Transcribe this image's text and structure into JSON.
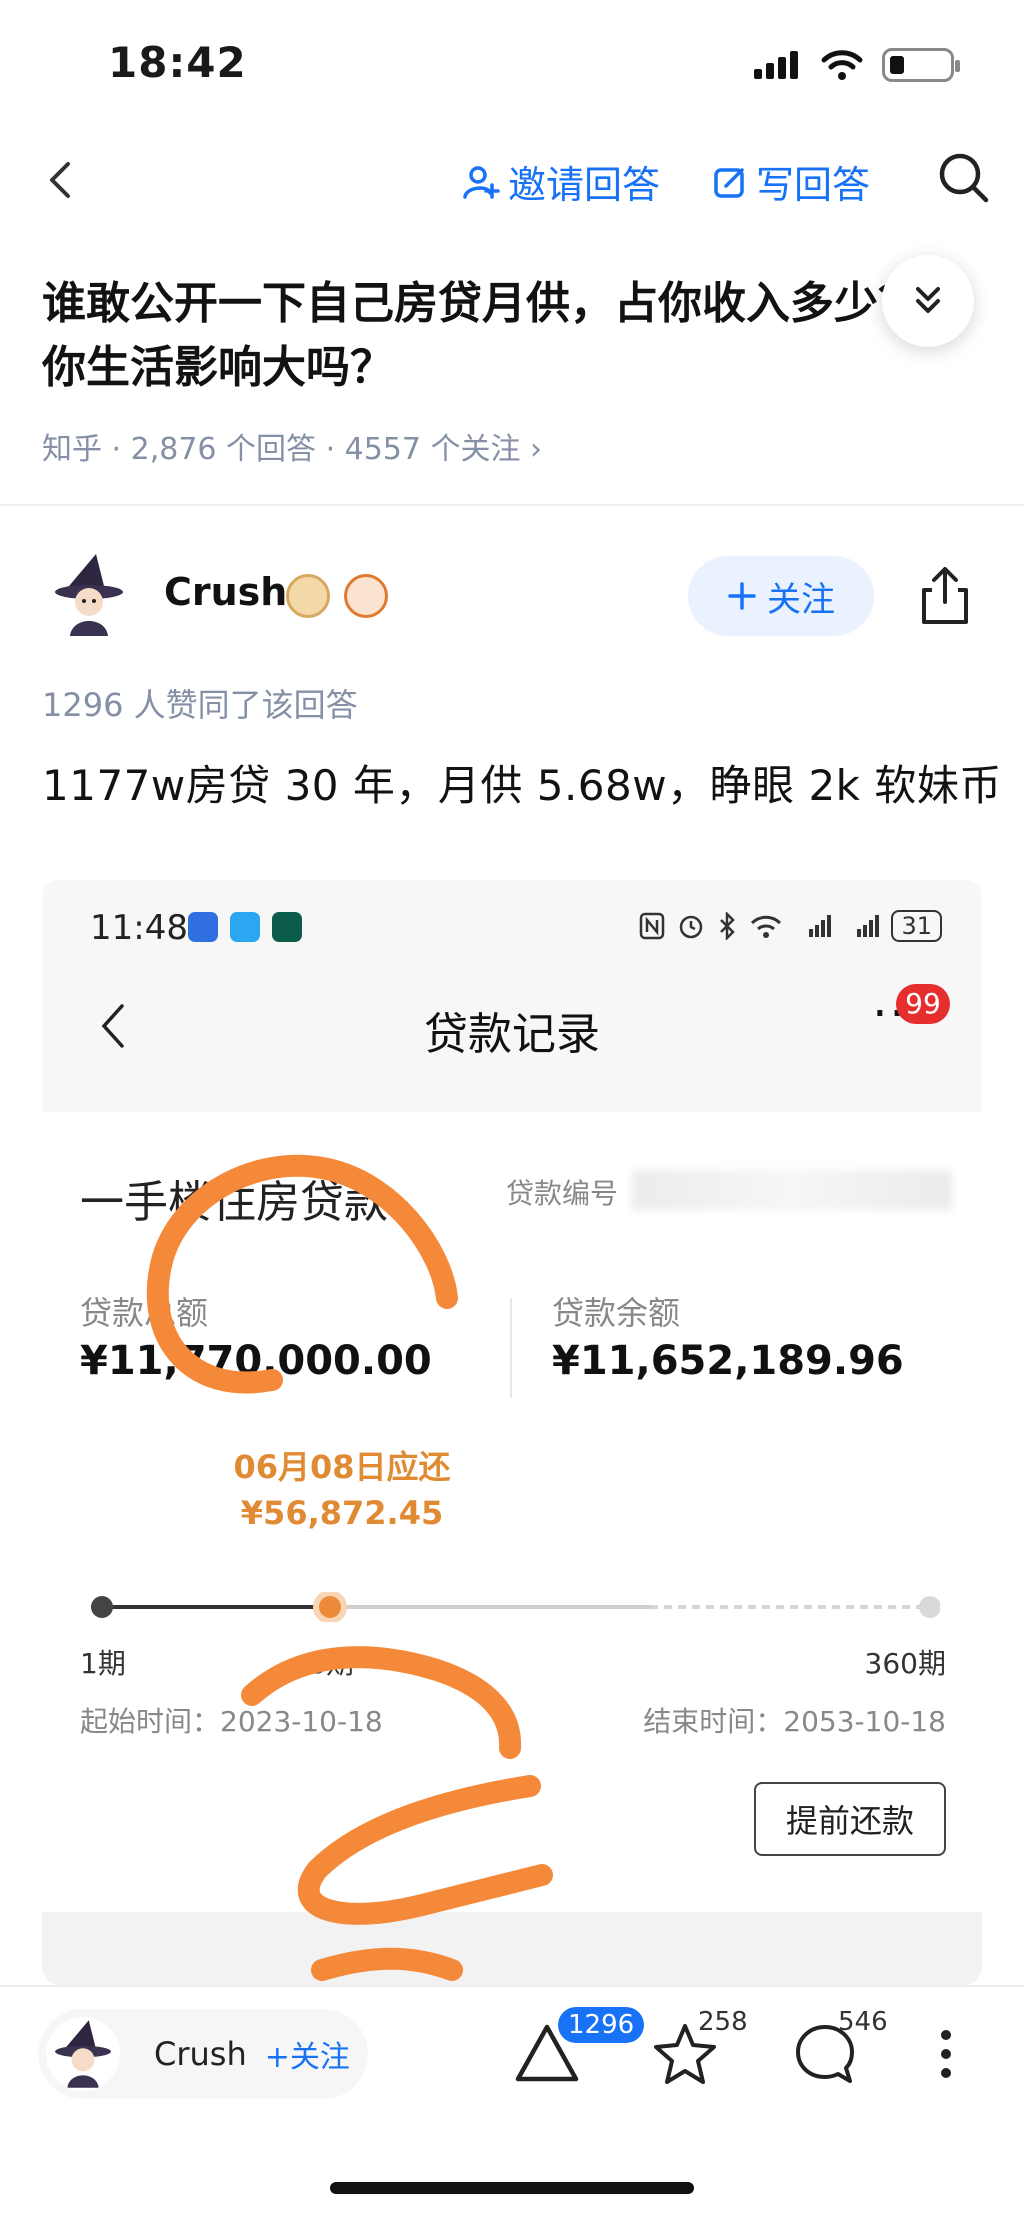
{
  "status_bar": {
    "time": "18:42"
  },
  "nav": {
    "invite_label": "邀请回答",
    "write_label": "写回答"
  },
  "question": {
    "title": "谁敢公开一下自己房贷月供，占你收入多少？对你生活影响大吗？",
    "meta": "知乎 · 2,876 个回答 · 4557 个关注 ›"
  },
  "author": {
    "name": "Crush",
    "follow_label": "关注"
  },
  "answer": {
    "likes_text": "1296 人赞同了该回答",
    "text": "1177w房贷 30 年，月供 5.68w，睁眼 2k 软妹币"
  },
  "embedded": {
    "time": "11:48",
    "battery": "31",
    "title": "贷款记录",
    "more": "···",
    "badge": "99",
    "loan_type": "一手楼住房贷款",
    "loan_no_label": "贷款编号",
    "total_label": "贷款总额",
    "total_value": "¥11,770,000.00",
    "balance_label": "贷款余额",
    "balance_value": "¥11,652,189.96",
    "due_label": "06月08日应还",
    "due_amount": "¥56,872.45",
    "period_start": "1期",
    "period_current": "8期",
    "period_end": "360期",
    "start_date": "起始时间：2023-10-18",
    "end_date": "结束时间：2053-10-18",
    "prepay_label": "提前还款",
    "progress": {
      "current": 8,
      "total": 360
    }
  },
  "bottom_bar": {
    "author_name": "Crush",
    "follow_label": "+关注",
    "likes": "1296",
    "favorites": "258",
    "comments": "546"
  },
  "colors": {
    "accent": "#1772f6",
    "due": "#e08a34",
    "badge": "#e62e2e",
    "scribble": "#f5893a"
  }
}
